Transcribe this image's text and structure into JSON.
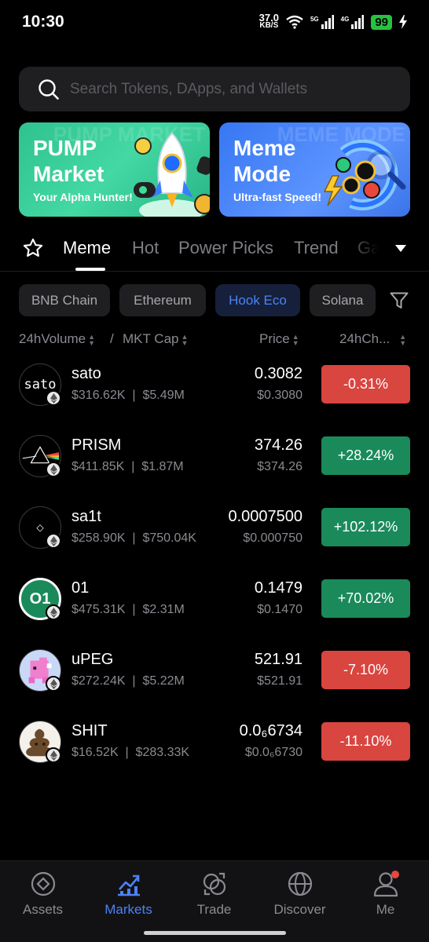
{
  "status_bar": {
    "time": "10:30",
    "net_speed_value": "37.0",
    "net_speed_unit": "KB/S",
    "signal1_label": "5G",
    "signal2_label": "4G",
    "battery": "99"
  },
  "search": {
    "placeholder": "Search Tokens, DApps, and Wallets"
  },
  "banners": [
    {
      "title": "PUMP Market",
      "subtitle": "Your Alpha Hunter!",
      "watermark": "PUMP MARKET",
      "color": "#2fc28f"
    },
    {
      "title": "Meme Mode",
      "subtitle": "Ultra-fast Speed!",
      "watermark": "MEME MODE",
      "color": "#3777f3"
    }
  ],
  "tabs": {
    "items": [
      {
        "label": "Meme",
        "active": true
      },
      {
        "label": "Hot",
        "active": false
      },
      {
        "label": "Power Picks",
        "active": false
      },
      {
        "label": "Trend",
        "active": false
      },
      {
        "label": "Ga",
        "active": false
      }
    ]
  },
  "chains": {
    "items": [
      {
        "label": "BNB Chain",
        "active": false
      },
      {
        "label": "Ethereum",
        "active": false
      },
      {
        "label": "Hook Eco",
        "active": true
      },
      {
        "label": "Solana",
        "active": false
      }
    ]
  },
  "sort": {
    "volume": "24hVolume",
    "separator": "/",
    "mkt_cap": "MKT Cap",
    "price": "Price",
    "change": "24hCh..."
  },
  "tokens": [
    {
      "name": "sato",
      "avatar_text": "sato",
      "volume": "$316.62K",
      "mkt_cap": "$5.49M",
      "price": "0.3082",
      "price_usd": "$0.3080",
      "change": "-0.31%",
      "direction": "down"
    },
    {
      "name": "PRISM",
      "avatar_text": "",
      "volume": "$411.85K",
      "mkt_cap": "$1.87M",
      "price": "374.26",
      "price_usd": "$374.26",
      "change": "+28.24%",
      "direction": "up"
    },
    {
      "name": "sa1t",
      "avatar_text": "◇",
      "volume": "$258.90K",
      "mkt_cap": "$750.04K",
      "price": "0.0007500",
      "price_usd": "$0.000750",
      "change": "+102.12%",
      "direction": "up"
    },
    {
      "name": "01",
      "avatar_text": "O1",
      "volume": "$475.31K",
      "mkt_cap": "$2.31M",
      "price": "0.1479",
      "price_usd": "$0.1470",
      "change": "+70.02%",
      "direction": "up"
    },
    {
      "name": "uPEG",
      "avatar_text": "",
      "volume": "$272.24K",
      "mkt_cap": "$5.22M",
      "price": "521.91",
      "price_usd": "$521.91",
      "change": "-7.10%",
      "direction": "down"
    },
    {
      "name": "SHIT",
      "avatar_text": "",
      "volume": "$16.52K",
      "mkt_cap": "$283.33K",
      "price": "0.0₆6734",
      "price_usd": "$0.0₆6730",
      "change": "-11.10%",
      "direction": "down"
    }
  ],
  "bottom_nav": {
    "items": [
      {
        "label": "Assets",
        "icon": "assets-icon",
        "active": false
      },
      {
        "label": "Markets",
        "icon": "markets-icon",
        "active": true
      },
      {
        "label": "Trade",
        "icon": "trade-icon",
        "active": false
      },
      {
        "label": "Discover",
        "icon": "discover-icon",
        "active": false
      },
      {
        "label": "Me",
        "icon": "me-icon",
        "active": false
      }
    ]
  },
  "colors": {
    "accent": "#4c82f5",
    "up": "#1a8a5b",
    "down": "#d9453f",
    "background": "#000000"
  }
}
